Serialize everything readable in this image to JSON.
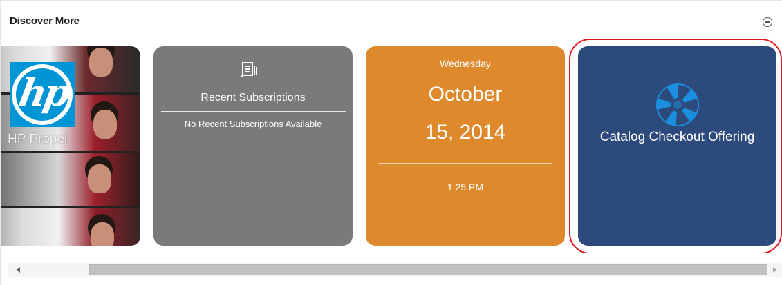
{
  "panel": {
    "title": "Discover More",
    "collapse_icon": "collapse-circle-minus-icon"
  },
  "tiles": {
    "hp_propel": {
      "logo_text": "hp",
      "caption": "HP Propel"
    },
    "subscriptions": {
      "icon": "subscriptions-document-icon",
      "title": "Recent Subscriptions",
      "empty_message": "No Recent Subscriptions Available"
    },
    "date": {
      "weekday": "Wednesday",
      "month": "October",
      "day_year": "15, 2014",
      "time": "1:25 PM"
    },
    "catalog": {
      "icon": "swirl-logo-icon",
      "label": "Catalog Checkout Offering"
    }
  },
  "colors": {
    "subscriptions_bg": "#7a7a7a",
    "date_bg": "#de8a2c",
    "catalog_bg": "#2d4a7c",
    "highlight": "#e21b23",
    "hp_blue": "#0096d6"
  },
  "scrollbar": {
    "left_icon": "scroll-left-arrow-icon",
    "right_icon": "scroll-right-arrow-icon"
  }
}
